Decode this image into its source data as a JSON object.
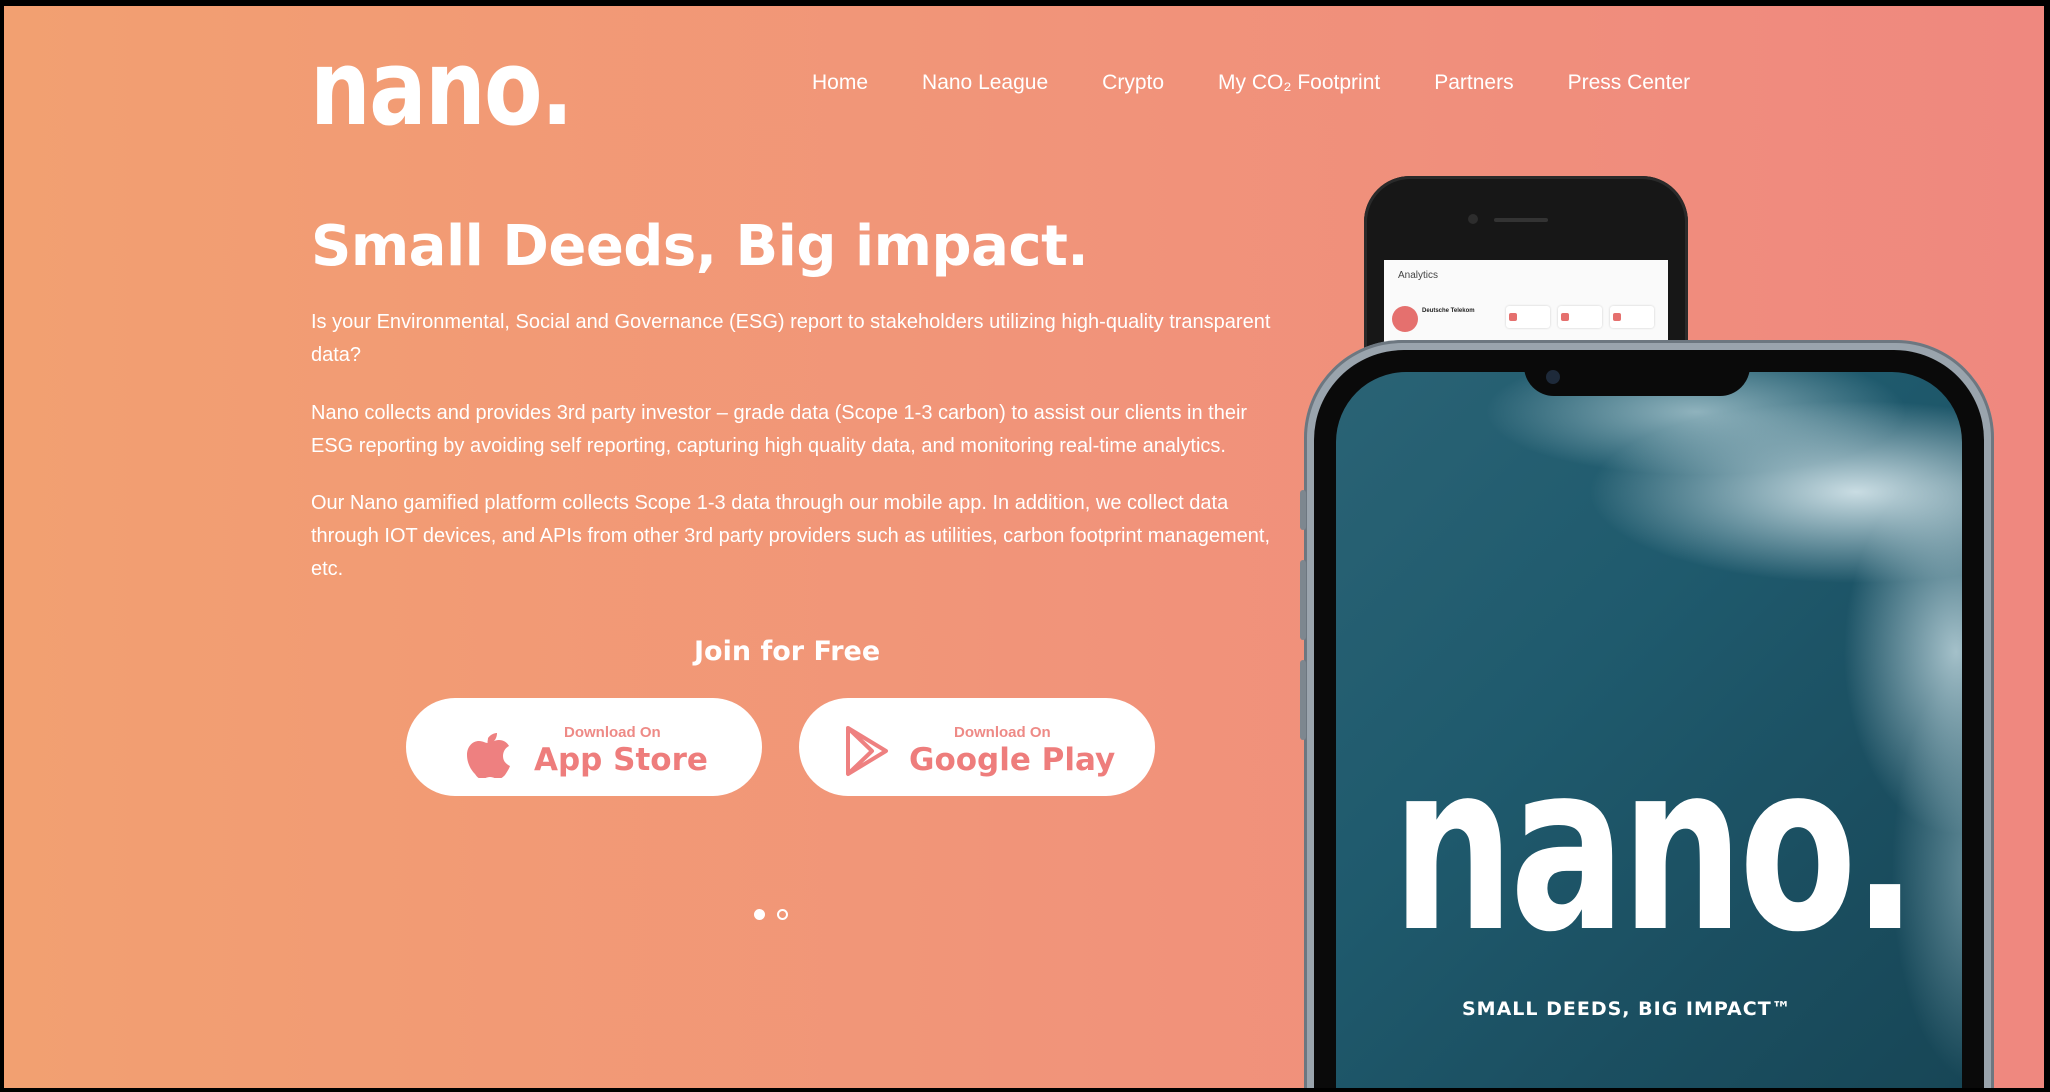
{
  "brand": {
    "logo": "nano."
  },
  "nav": {
    "items": [
      "Home",
      "Nano League",
      "Crypto",
      "My CO₂ Footprint",
      "Partners",
      "Press Center"
    ]
  },
  "hero": {
    "headline": "Small Deeds, Big impact.",
    "paragraph1": "Is your Environmental, Social and Governance (ESG) report to stakeholders utilizing high-quality transparent data?",
    "paragraph2": "Nano collects and provides 3rd party investor – grade data (Scope 1-3 carbon) to assist our clients in their ESG reporting by avoiding self reporting, capturing high quality data, and monitoring real-time analytics.",
    "paragraph3": "Our Nano gamified platform collects Scope 1-3 data through our mobile app. In addition, we collect data through IOT devices, and APIs from other 3rd party providers such as utilities, carbon footprint management, etc.",
    "cta": "Join for Free"
  },
  "stores": {
    "apple": {
      "small": "Download On",
      "big": "App Store",
      "icon": "apple-icon"
    },
    "google": {
      "small": "Download On",
      "big": "Google Play",
      "icon": "google-play-icon"
    }
  },
  "carousel": {
    "total": 2,
    "active": 1
  },
  "phone_back": {
    "screen_title": "Analytics",
    "company": "Deutsche Telekom"
  },
  "phone_front": {
    "logo": "nano.",
    "tagline": "SMALL DEEDS, BIG IMPACT™"
  },
  "colors": {
    "gradient_start": "#f2a071",
    "gradient_end": "#ef887f",
    "button_text": "#ee7d7c"
  }
}
